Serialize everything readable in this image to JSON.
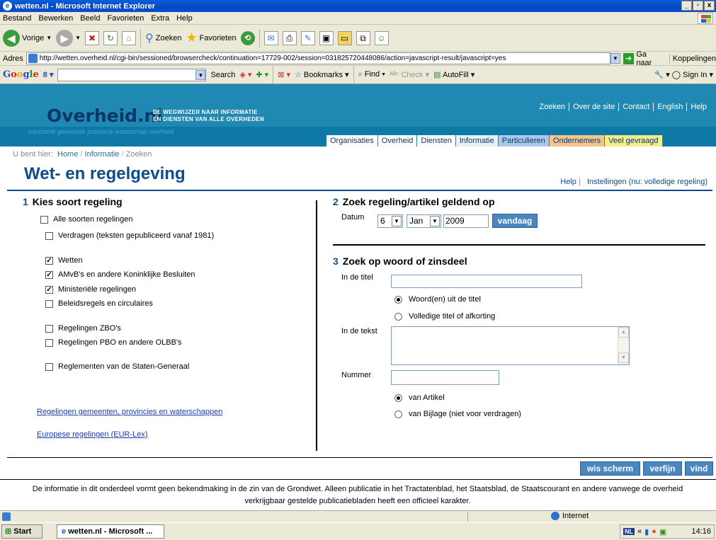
{
  "window": {
    "title": "wetten.nl - Microsoft Internet Explorer"
  },
  "menubar": [
    "Bestand",
    "Bewerken",
    "Beeld",
    "Favorieten",
    "Extra",
    "Help"
  ],
  "toolbar": {
    "back": "Vorige",
    "search": "Zoeken",
    "favorites": "Favorieten"
  },
  "address": {
    "label": "Adres",
    "url": "http://wetten.overheid.nl/cgi-bin/sessioned/browsercheck/continuation=17729-002/session=031825720448086/action=javascript-result/javascript=yes",
    "go": "Ga naar",
    "links": "Koppelingen"
  },
  "google": {
    "logo": "Google",
    "search": "Search",
    "bookmarks": "Bookmarks",
    "find": "Find",
    "check": "Check",
    "autofill": "AutoFill",
    "signin": "Sign In"
  },
  "header": {
    "logo": "Overheid.nl",
    "tagline1": "DE WEGWIJZER NAAR INFORMATIE",
    "tagline2": "EN DIENSTEN VAN ALLE OVERHEDEN",
    "deco": "ministerie  gemeente  provincie  waterschap  overheid",
    "toplinks": [
      "Zoeken",
      "Over de site",
      "Contact",
      "English",
      "Help"
    ],
    "tabs": [
      "Organisaties",
      "Overheid",
      "Diensten",
      "Informatie",
      "Particulieren",
      "Ondernemers",
      "Veel gevraagd"
    ]
  },
  "breadcrumb": {
    "prefix": "U bent hier:",
    "home": "Home",
    "info": "Informatie",
    "current": "Zoeken"
  },
  "page": {
    "title": "Wet- en regelgeving",
    "help": "Help",
    "settings": "Instellingen (nu: volledige regeling)"
  },
  "section1": {
    "num": "1",
    "title": "Kies soort regeling",
    "all": "Alle soorten regelingen",
    "verdragen": "Verdragen (teksten gepubliceerd vanaf 1981)",
    "wetten": "Wetten",
    "amvb": "AMvB's en andere Koninklijke Besluiten",
    "min": "Ministeriële regelingen",
    "beleid": "Beleidsregels en circulaires",
    "zbo": "Regelingen ZBO's",
    "pbo": "Regelingen PBO en andere OLBB's",
    "staten": "Reglementen van de Staten-Generaal",
    "link1": "Regelingen gemeenten, provincies en waterschappen",
    "link2": "Europese regelingen (EUR-Lex)"
  },
  "section2": {
    "num": "2",
    "title": "Zoek regeling/artikel geldend op",
    "datum": "Datum",
    "day": "6",
    "month": "Jan",
    "year": "2009",
    "today": "vandaag"
  },
  "section3": {
    "num": "3",
    "title": "Zoek op woord of zinsdeel",
    "intitel": "In de titel",
    "opt1": "Woord(en) uit de titel",
    "opt2": "Volledige titel of afkorting",
    "intekst": "In de tekst",
    "nummer": "Nummer",
    "opt3": "van Artikel",
    "opt4": "van Bijlage (niet voor verdragen)"
  },
  "actions": {
    "clear": "wis scherm",
    "refine": "verfijn",
    "find": "vind"
  },
  "disclaimer": "De informatie in dit onderdeel vormt geen bekendmaking in de zin van de Grondwet. Alleen publicatie in het Tractatenblad, het Staatsblad, de Staatscourant en andere vanwege de overheid verkrijgbaar gestelde publicatiebladen heeft een officieel karakter.",
  "status": {
    "zone": "Internet"
  },
  "taskbar": {
    "start": "Start",
    "task": "wetten.nl - Microsoft ...",
    "lang": "NL",
    "clock": "14:16"
  },
  "colors": {
    "header": "#1f88b3",
    "title": "#0f4c8c",
    "button": "#4a87c0"
  }
}
